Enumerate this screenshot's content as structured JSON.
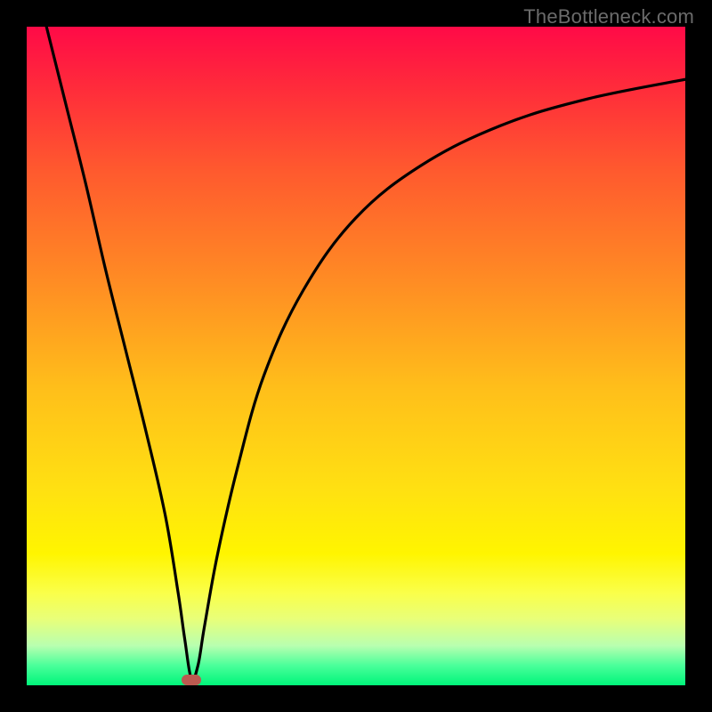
{
  "watermark": "TheBottleneck.com",
  "chart_data": {
    "type": "line",
    "title": "",
    "xlabel": "",
    "ylabel": "",
    "xlim": [
      0,
      100
    ],
    "ylim": [
      0,
      100
    ],
    "series": [
      {
        "name": "curve",
        "x": [
          3,
          6,
          9,
          12,
          15,
          18,
          21,
          23,
          24,
          25,
          26,
          27,
          29,
          32,
          36,
          42,
          50,
          60,
          72,
          85,
          100
        ],
        "values": [
          100,
          88,
          76,
          63,
          51,
          39,
          26,
          14,
          7,
          1,
          3,
          9,
          20,
          33,
          47,
          60,
          71,
          79,
          85,
          89,
          92
        ]
      }
    ],
    "annotations": [
      {
        "name": "min-marker",
        "x": 25,
        "y": 0.8
      }
    ],
    "gradient_stops": [
      {
        "pct": 0,
        "color": "#ff0a47"
      },
      {
        "pct": 10,
        "color": "#ff2e3a"
      },
      {
        "pct": 22,
        "color": "#ff5a2e"
      },
      {
        "pct": 38,
        "color": "#ff8a24"
      },
      {
        "pct": 55,
        "color": "#ffbf1a"
      },
      {
        "pct": 70,
        "color": "#ffe012"
      },
      {
        "pct": 80,
        "color": "#fff500"
      },
      {
        "pct": 86,
        "color": "#faff4a"
      },
      {
        "pct": 90,
        "color": "#e8ff7a"
      },
      {
        "pct": 94,
        "color": "#b8ffb0"
      },
      {
        "pct": 97,
        "color": "#4aff9a"
      },
      {
        "pct": 100,
        "color": "#00f57a"
      }
    ],
    "colors": {
      "curve": "#000000",
      "marker": "#bb5a50",
      "frame": "#000000"
    }
  }
}
